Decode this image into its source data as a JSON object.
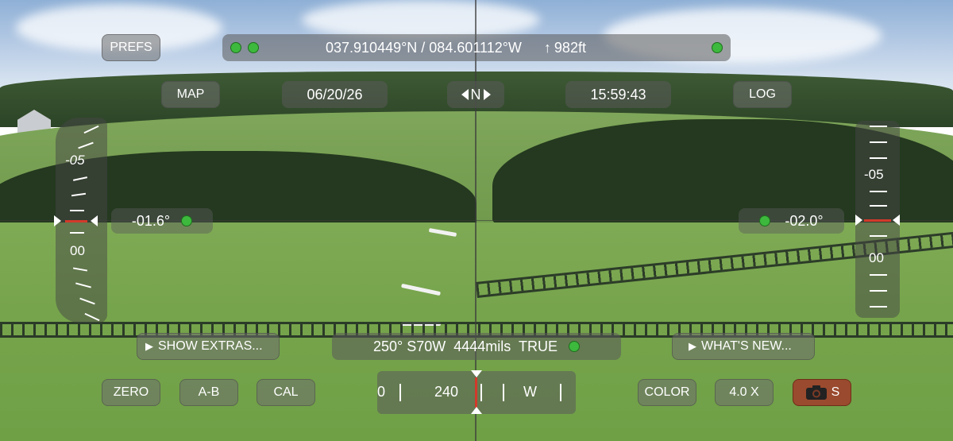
{
  "top_bar": {
    "coordinates": "037.910449°N / 084.601112°W",
    "altitude": "982ft",
    "altitude_arrow": "↑"
  },
  "buttons": {
    "prefs": "PREFS",
    "map": "MAP",
    "log": "LOG",
    "show_extras": "SHOW EXTRAS...",
    "whats_new": "WHAT'S NEW...",
    "zero": "ZERO",
    "a_b": "A-B",
    "cal": "CAL",
    "color": "COLOR",
    "zoom": "4.0 X",
    "camera_suffix": "S"
  },
  "info": {
    "date": "06/20/26",
    "time": "15:59:43",
    "north_indicator": "N"
  },
  "inclination": {
    "left_value": "-01.6°",
    "right_value": "-02.0°"
  },
  "left_scale": {
    "labels": [
      "-05",
      "00"
    ]
  },
  "right_scale": {
    "labels": [
      "-05",
      "00"
    ]
  },
  "heading": {
    "readout": "250° S70W  4444mils  TRUE",
    "compass_value": "240",
    "compass_dir": "W",
    "compass_left_edge": "0"
  },
  "colors": {
    "indicator_green": "#3db93d",
    "marker_red": "#d23a2a",
    "camera_button": "#9a4a2e"
  }
}
